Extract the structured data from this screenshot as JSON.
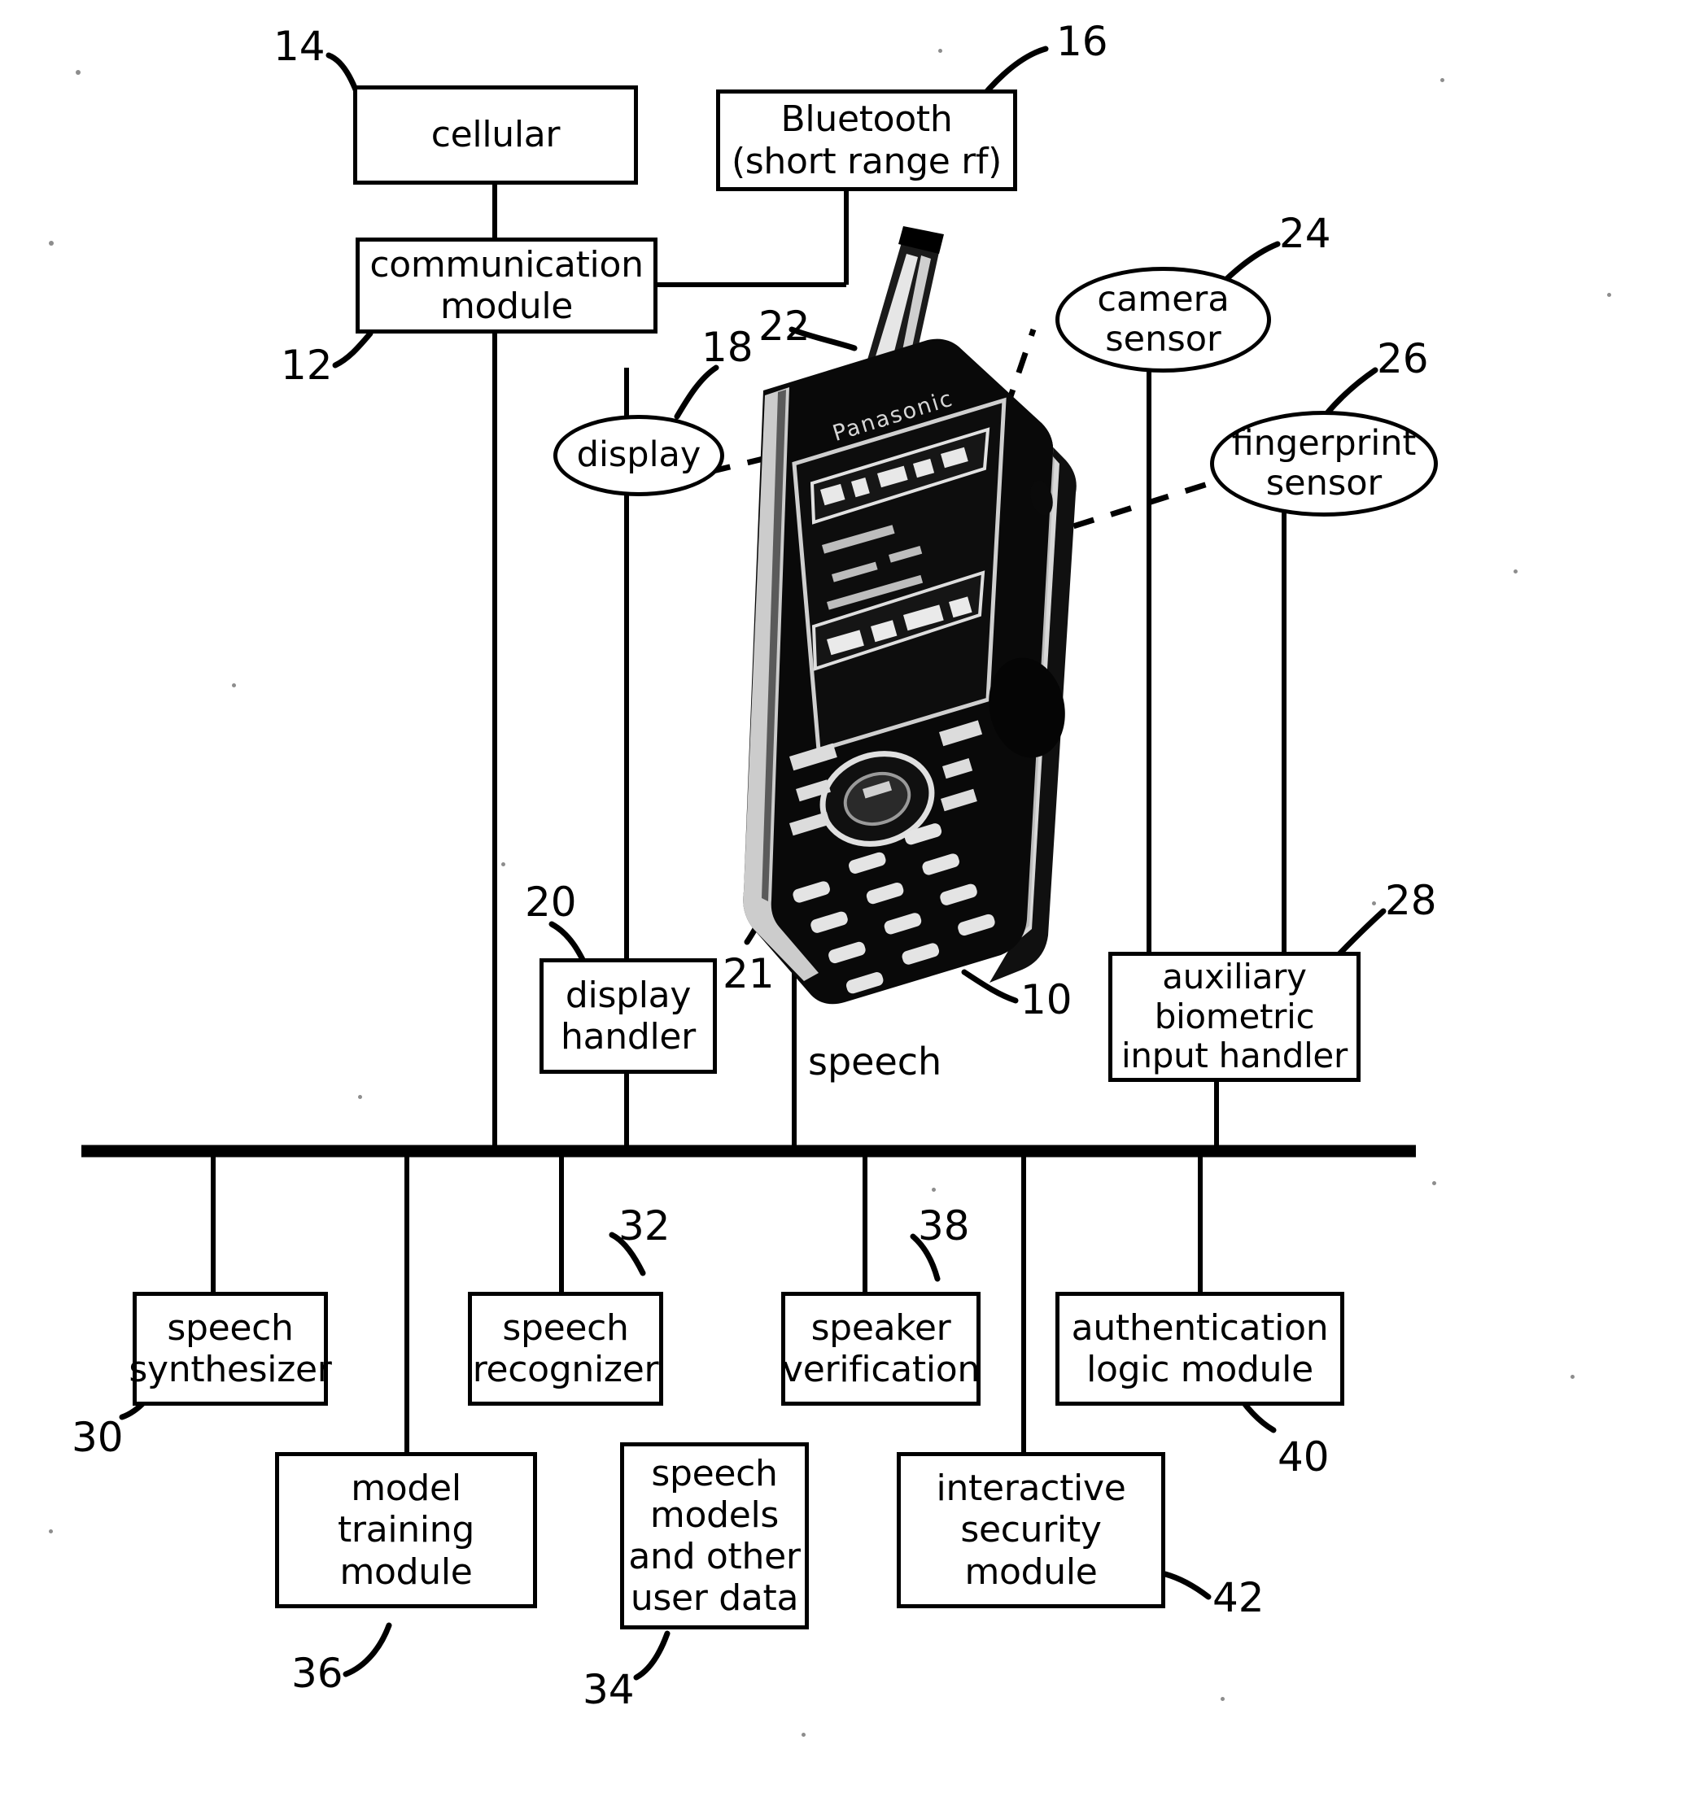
{
  "figure": {
    "title": "Mobile device speech and biometric security architecture block diagram",
    "device_label": "10",
    "device_brand_text": "Panasonic"
  },
  "boxes": [
    {
      "id": "cellular",
      "ref": "14",
      "lines": [
        "cellular"
      ]
    },
    {
      "id": "bluetooth",
      "ref": "16",
      "lines": [
        "Bluetooth",
        "(short range rf)"
      ]
    },
    {
      "id": "communication",
      "ref": "12",
      "lines": [
        "communication",
        "module"
      ]
    },
    {
      "id": "display_handler",
      "ref": "20",
      "lines": [
        "display",
        "handler"
      ]
    },
    {
      "id": "aux_biometric",
      "ref": "28",
      "lines": [
        "auxiliary",
        "biometric",
        "input handler"
      ]
    },
    {
      "id": "speech_synth",
      "ref": "30",
      "lines": [
        "speech",
        "synthesizer"
      ]
    },
    {
      "id": "speech_recog",
      "ref": "32",
      "lines": [
        "speech",
        "recognizer"
      ]
    },
    {
      "id": "speaker_verif",
      "ref": "38",
      "lines": [
        "speaker",
        "verification"
      ]
    },
    {
      "id": "auth_logic",
      "ref": "40",
      "lines": [
        "authentication",
        "logic module"
      ]
    },
    {
      "id": "model_training",
      "ref": "36",
      "lines": [
        "model",
        "training",
        "module"
      ]
    },
    {
      "id": "speech_models",
      "ref": "34",
      "lines": [
        "speech",
        "models",
        "and other",
        "user data"
      ]
    },
    {
      "id": "interactive_sec",
      "ref": "42",
      "lines": [
        "interactive",
        "security",
        "module"
      ]
    }
  ],
  "ellipses": [
    {
      "id": "display",
      "ref": "18",
      "lines": [
        "display"
      ]
    },
    {
      "id": "camera_sensor",
      "ref": "24",
      "lines": [
        "camera",
        "sensor"
      ]
    },
    {
      "id": "fingerprint_sensor",
      "ref": "26",
      "lines": [
        "fingerprint",
        "sensor"
      ]
    }
  ],
  "free_labels": [
    {
      "id": "speech_label",
      "text": "speech"
    }
  ],
  "ref_numbers": {
    "cellular": "14",
    "bluetooth": "16",
    "communication": "12",
    "display": "18",
    "display_handler": "20",
    "keypad": "21",
    "antenna": "22",
    "camera_sensor": "24",
    "fingerprint_sensor": "26",
    "aux_biometric": "28",
    "speech_synth": "30",
    "speech_recog": "32",
    "speech_models": "34",
    "model_training": "36",
    "speaker_verif": "38",
    "auth_logic": "40",
    "interactive_sec": "42",
    "device": "10"
  },
  "colors": {
    "stroke": "#000000",
    "background": "#ffffff",
    "speck": "#8d8d8d"
  }
}
